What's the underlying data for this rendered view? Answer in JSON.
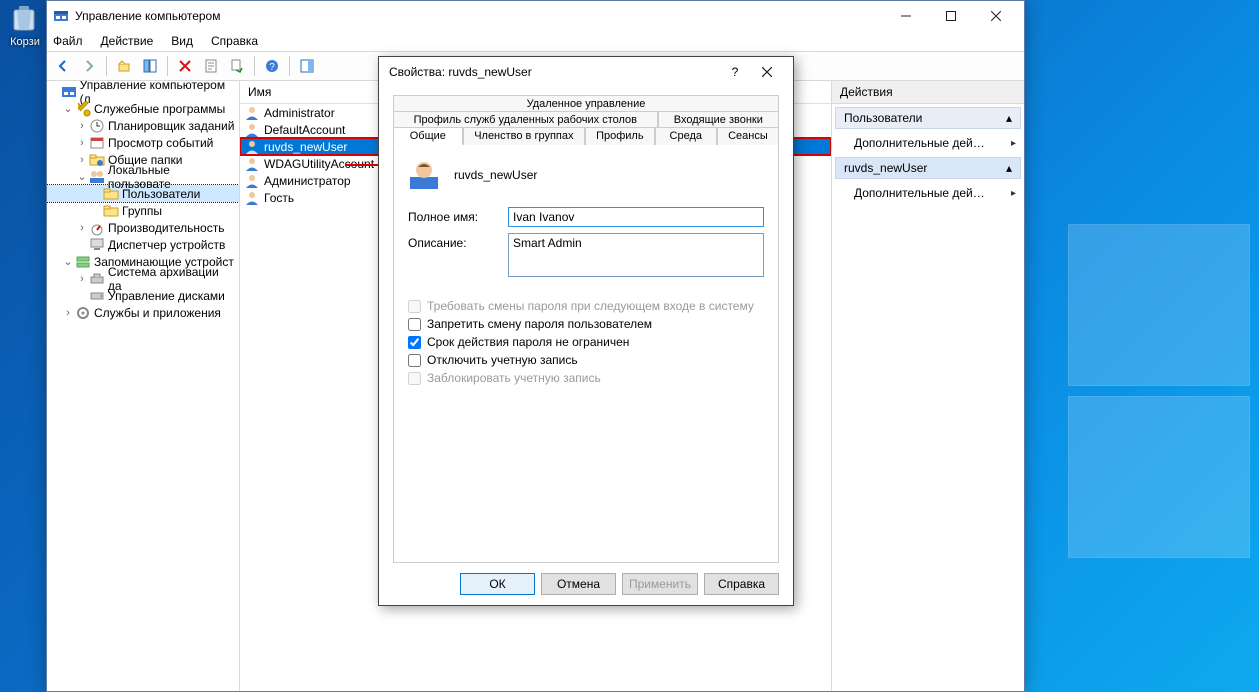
{
  "desktop": {
    "recycle_bin": "Корзи"
  },
  "mgmt_window": {
    "title": "Управление компьютером",
    "menu": {
      "file": "Файл",
      "action": "Действие",
      "view": "Вид",
      "help": "Справка"
    },
    "tree": {
      "root": "Управление компьютером (л",
      "utilities": "Служебные программы",
      "task_scheduler": "Планировщик заданий",
      "event_viewer": "Просмотр событий",
      "shared_folders": "Общие папки",
      "local_users": "Локальные пользовате",
      "users": "Пользователи",
      "groups": "Группы",
      "performance": "Производительность",
      "device_manager": "Диспетчер устройств",
      "storage": "Запоминающие устройст",
      "backup": "Система архивации да",
      "disk_mgmt": "Управление дисками",
      "services": "Службы и приложения"
    },
    "list": {
      "header": "Имя",
      "rows": [
        "Administrator",
        "DefaultAccount",
        "ruvds_newUser",
        "WDAGUtilityAccount",
        "Администратор",
        "Гость"
      ]
    },
    "actions": {
      "header": "Действия",
      "group1": "Пользователи",
      "item1": "Дополнительные дей…",
      "group2": "ruvds_newUser",
      "item2": "Дополнительные дей…"
    }
  },
  "dialog": {
    "title": "Свойства: ruvds_newUser",
    "tabs": {
      "remote_control": "Удаленное управление",
      "rds_profile": "Профиль служб удаленных рабочих столов",
      "incoming_calls": "Входящие звонки",
      "general": "Общие",
      "member_of": "Членство в группах",
      "profile": "Профиль",
      "environment": "Среда",
      "sessions": "Сеансы"
    },
    "user_title": "ruvds_newUser",
    "labels": {
      "full_name": "Полное имя:",
      "description": "Описание:"
    },
    "values": {
      "full_name": "Ivan Ivanov",
      "description": "Smart Admin"
    },
    "checks": {
      "must_change": "Требовать смены пароля при следующем входе в систему",
      "cannot_change": "Запретить смену пароля пользователем",
      "never_expires": "Срок действия пароля не ограничен",
      "disabled": "Отключить учетную запись",
      "locked": "Заблокировать учетную запись"
    },
    "buttons": {
      "ok": "ОК",
      "cancel": "Отмена",
      "apply": "Применить",
      "help": "Справка"
    }
  }
}
